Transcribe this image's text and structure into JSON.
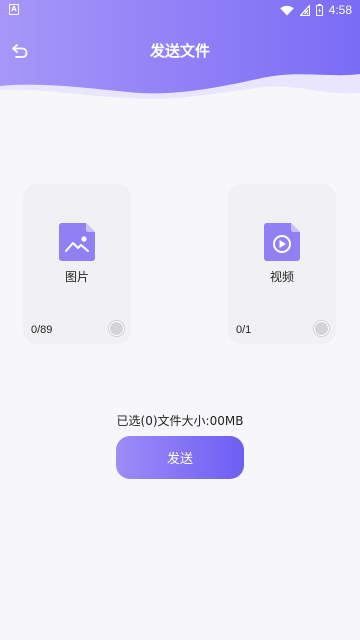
{
  "colors": {
    "accent": "#7b6cf6",
    "accent_light": "#a697f8",
    "background": "#f7f7f9",
    "card": "#f1f1f3"
  },
  "status_bar": {
    "left_icon": "A",
    "time": "4:58",
    "icons": [
      "wifi-icon",
      "signal-off-icon",
      "battery-icon"
    ]
  },
  "header": {
    "title": "发送文件",
    "back_icon": "undo-arrow-icon"
  },
  "cards": [
    {
      "label": "图片",
      "count": "0/89",
      "icon": "image-file-icon",
      "selected": false
    },
    {
      "label": "视频",
      "count": "0/1",
      "icon": "video-file-icon",
      "selected": false
    }
  ],
  "summary": "已选(0)文件大小:00MB",
  "send_button": "发送"
}
